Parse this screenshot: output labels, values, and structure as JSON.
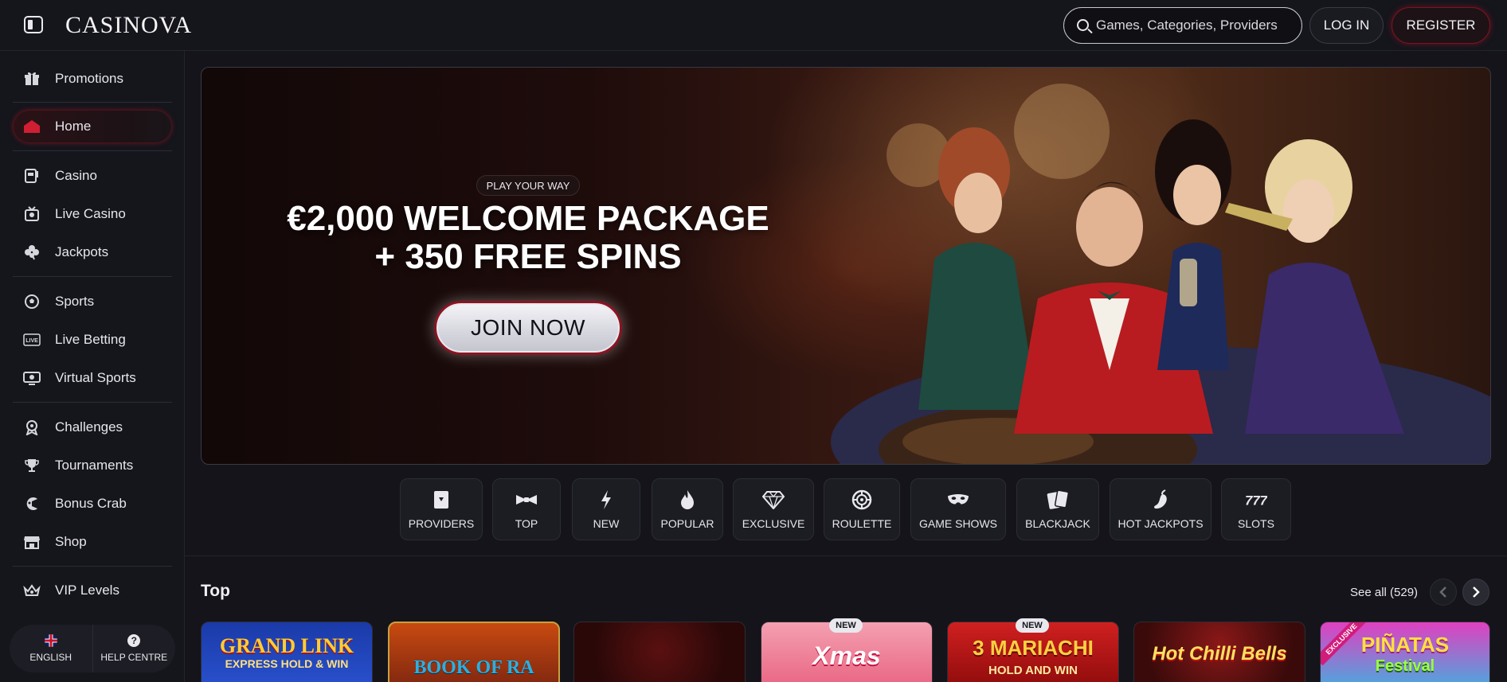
{
  "header": {
    "logo_text": "CASINOVA",
    "search_placeholder": "Games, Categories, Providers",
    "login_label": "LOG IN",
    "register_label": "REGISTER"
  },
  "sidebar": {
    "items": [
      {
        "label": "Promotions",
        "icon": "gift-icon"
      },
      {
        "label": "Home",
        "icon": "home-icon",
        "active": true
      },
      {
        "label": "Casino",
        "icon": "slot-machine-icon"
      },
      {
        "label": "Live Casino",
        "icon": "live-casino-icon"
      },
      {
        "label": "Jackpots",
        "icon": "clover-icon"
      },
      {
        "label": "Sports",
        "icon": "soccer-ball-icon"
      },
      {
        "label": "Live Betting",
        "icon": "live-badge-icon"
      },
      {
        "label": "Virtual Sports",
        "icon": "virtual-sports-icon"
      },
      {
        "label": "Challenges",
        "icon": "medal-icon"
      },
      {
        "label": "Tournaments",
        "icon": "trophy-icon"
      },
      {
        "label": "Bonus Crab",
        "icon": "crab-icon"
      },
      {
        "label": "Shop",
        "icon": "shop-icon"
      },
      {
        "label": "VIP Levels",
        "icon": "crown-icon"
      }
    ],
    "language_label": "ENGLISH",
    "help_label": "HELP CENTRE",
    "help_icon_glyph": "?"
  },
  "hero": {
    "tag": "PLAY YOUR WAY",
    "title_line1": "€2,000 WELCOME PACKAGE",
    "title_line2": "+ 350 FREE SPINS",
    "cta_label": "JOIN NOW"
  },
  "categories": [
    {
      "label": "PROVIDERS",
      "icon": "providers-icon"
    },
    {
      "label": "TOP",
      "icon": "bowtie-icon"
    },
    {
      "label": "NEW",
      "icon": "lightning-icon"
    },
    {
      "label": "POPULAR",
      "icon": "flame-icon"
    },
    {
      "label": "EXCLUSIVE",
      "icon": "diamond-icon"
    },
    {
      "label": "ROULETTE",
      "icon": "roulette-icon"
    },
    {
      "label": "GAME SHOWS",
      "icon": "mask-icon"
    },
    {
      "label": "BLACKJACK",
      "icon": "cards-icon"
    },
    {
      "label": "HOT JACKPOTS",
      "icon": "chili-icon"
    },
    {
      "label": "SLOTS",
      "icon": "sevens-icon"
    }
  ],
  "top_section": {
    "title": "Top",
    "see_all": "See all (529)",
    "games": [
      {
        "title": "GRAND LINK",
        "subtitle": "EXPRESS HOLD & WIN",
        "badge": ""
      },
      {
        "title": "BOOK OF RA",
        "subtitle": "",
        "badge": ""
      },
      {
        "title": "",
        "subtitle": "",
        "badge": ""
      },
      {
        "title": "Xmas",
        "subtitle": "",
        "badge": "NEW"
      },
      {
        "title": "3 MARIACHI",
        "subtitle": "HOLD AND WIN",
        "badge": "NEW"
      },
      {
        "title": "Hot Chilli Bells",
        "subtitle": "",
        "badge": ""
      },
      {
        "title": "PIÑATAS",
        "subtitle": "Festival",
        "badge": "",
        "ribbon": "EXCLUSIVE"
      }
    ]
  },
  "colors": {
    "background": "#14141a",
    "accent_red": "#d01f32",
    "panel": "#1c1c23"
  }
}
